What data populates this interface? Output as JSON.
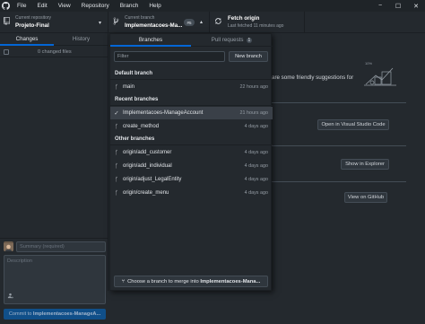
{
  "menubar": {
    "items": [
      "File",
      "Edit",
      "View",
      "Repository",
      "Branch",
      "Help"
    ],
    "logo_icon": "github-icon",
    "window_controls": [
      "−",
      "☐",
      "✕"
    ]
  },
  "toolbar": {
    "repository": {
      "label": "Current repository",
      "value": "Projeto-Final"
    },
    "branch": {
      "label": "Current branch",
      "value": "Implementacoes-Ma...",
      "pr_badge": "#5"
    },
    "fetch": {
      "label": "Fetch origin",
      "sub": "Last fetched 11 minutes ago"
    }
  },
  "left": {
    "tabs": [
      "Changes",
      "History"
    ],
    "changed_files": "0 changed files",
    "summary_placeholder": "Summary (required)",
    "description_placeholder": "Description",
    "commit_prefix": "Commit to ",
    "commit_branch": "Implementacoes-ManageA..."
  },
  "main": {
    "suggestion_text": "are some friendly suggestions for",
    "buttons": [
      "Open in Visual Studio Code",
      "Show in Explorer",
      "View on GitHub"
    ]
  },
  "dropdown": {
    "tabs": [
      "Branches",
      "Pull requests"
    ],
    "pr_count": "1",
    "filter_placeholder": "Filter",
    "new_branch": "New branch",
    "groups": {
      "default": "Default branch",
      "recent": "Recent branches",
      "other": "Other branches"
    },
    "default_branches": [
      {
        "name": "main",
        "time": "22 hours ago"
      }
    ],
    "recent_branches": [
      {
        "name": "Implementacoes-ManageAccount",
        "time": "21 hours ago",
        "selected": true
      },
      {
        "name": "create_method",
        "time": "4 days ago"
      }
    ],
    "other_branches": [
      {
        "name": "origin/add_customer",
        "time": "4 days ago"
      },
      {
        "name": "origin/add_individual",
        "time": "4 days ago"
      },
      {
        "name": "origin/adjust_LegalEntity",
        "time": "4 days ago"
      },
      {
        "name": "origin/create_menu",
        "time": "4 days ago"
      }
    ],
    "merge_prefix": "Choose a branch to merge into ",
    "merge_branch": "Implementacoes-Mana..."
  },
  "colors": {
    "background": "#24292e",
    "accent": "#0366d6",
    "selected_row": "#3a4048"
  }
}
